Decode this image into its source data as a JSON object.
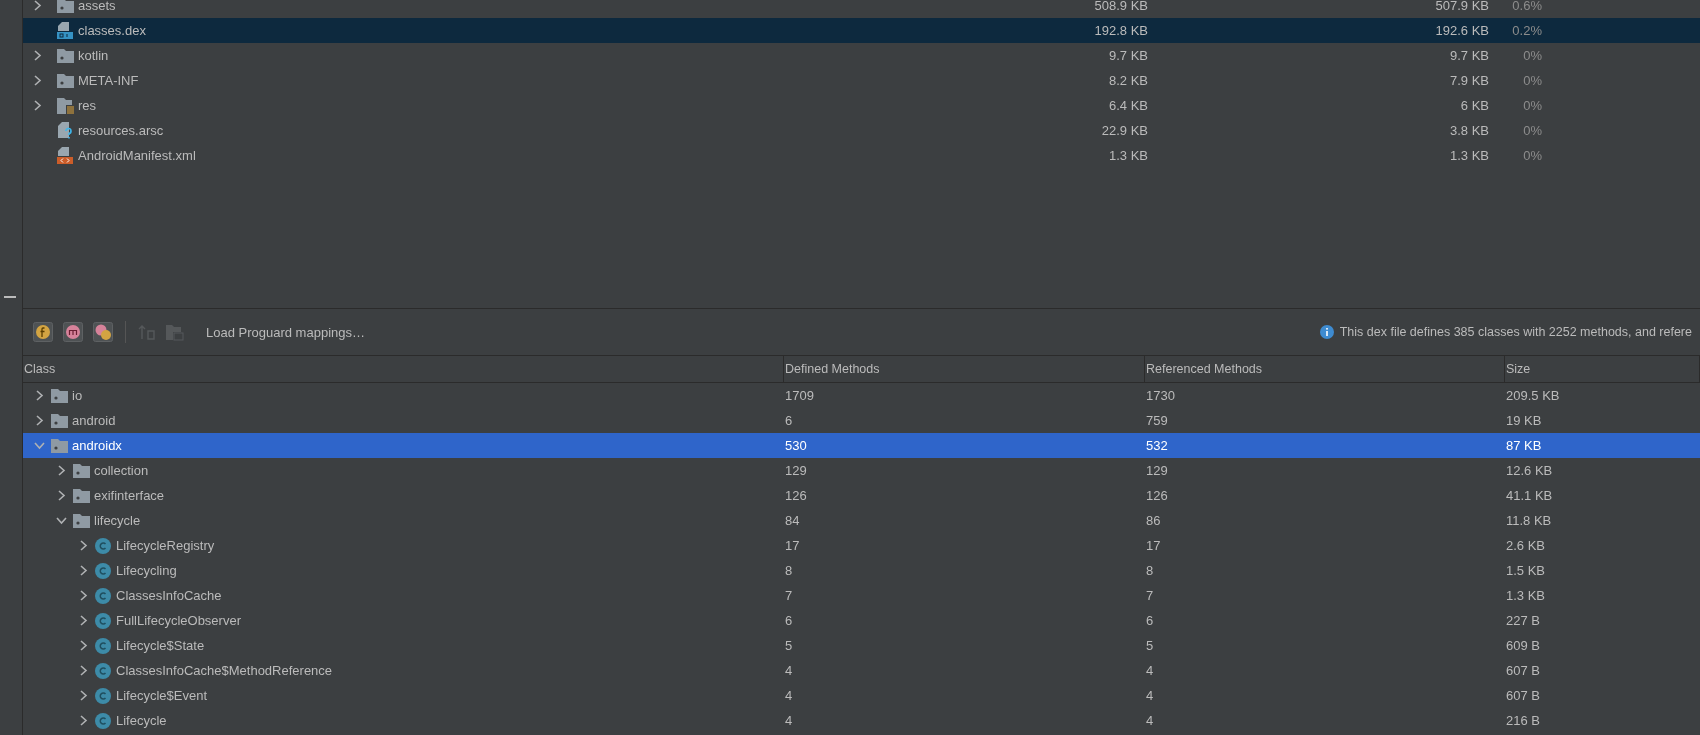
{
  "apk_tree": {
    "rows": [
      {
        "name": "assets",
        "kind": "folder",
        "selected": false,
        "raw_size": "508.9 KB",
        "download_size": "507.9 KB",
        "percent": "0.6%"
      },
      {
        "name": "classes.dex",
        "kind": "dex",
        "selected": true,
        "raw_size": "192.8 KB",
        "download_size": "192.6 KB",
        "percent": "0.2%"
      },
      {
        "name": "kotlin",
        "kind": "folder",
        "selected": false,
        "raw_size": "9.7 KB",
        "download_size": "9.7 KB",
        "percent": "0%"
      },
      {
        "name": "META-INF",
        "kind": "folder",
        "selected": false,
        "raw_size": "8.2 KB",
        "download_size": "7.9 KB",
        "percent": "0%"
      },
      {
        "name": "res",
        "kind": "res",
        "selected": false,
        "raw_size": "6.4 KB",
        "download_size": "6 KB",
        "percent": "0%"
      },
      {
        "name": "resources.arsc",
        "kind": "arsc",
        "selected": false,
        "raw_size": "22.9 KB",
        "download_size": "3.8 KB",
        "percent": "0%"
      },
      {
        "name": "AndroidManifest.xml",
        "kind": "manifest",
        "selected": false,
        "raw_size": "1.3 KB",
        "download_size": "1.3 KB",
        "percent": "0%"
      }
    ]
  },
  "toolbar": {
    "buttons": [
      {
        "kind": "fields",
        "disabled": false
      },
      {
        "kind": "methods",
        "disabled": false
      },
      {
        "kind": "referenced",
        "disabled": false
      },
      {
        "kind": "deobfuscate",
        "disabled": true
      },
      {
        "kind": "load-file",
        "disabled": true
      }
    ],
    "load_button": "Load Proguard mappings…",
    "info": "This dex file defines 385 classes with 2252 methods, and refere"
  },
  "class_table": {
    "columns": [
      "Class",
      "Defined Methods",
      "Referenced Methods",
      "Size"
    ],
    "rows": [
      {
        "name": "io",
        "kind": "package",
        "expanded": false,
        "selected": false,
        "defined": "1709",
        "referenced": "1730",
        "size": "209.5 KB"
      },
      {
        "name": "android",
        "kind": "package",
        "expanded": false,
        "selected": false,
        "defined": "6",
        "referenced": "759",
        "size": "19 KB"
      },
      {
        "name": "androidx",
        "kind": "package",
        "expanded": true,
        "selected": true,
        "defined": "530",
        "referenced": "532",
        "size": "87 KB",
        "children": [
          {
            "name": "collection",
            "kind": "package",
            "expanded": false,
            "selected": false,
            "defined": "129",
            "referenced": "129",
            "size": "12.6 KB"
          },
          {
            "name": "exifinterface",
            "kind": "package",
            "expanded": false,
            "selected": false,
            "defined": "126",
            "referenced": "126",
            "size": "41.1 KB"
          },
          {
            "name": "lifecycle",
            "kind": "package",
            "expanded": true,
            "selected": false,
            "defined": "84",
            "referenced": "86",
            "size": "11.8 KB",
            "children": [
              {
                "name": "LifecycleRegistry",
                "kind": "class",
                "expanded": false,
                "selected": false,
                "defined": "17",
                "referenced": "17",
                "size": "2.6 KB"
              },
              {
                "name": "Lifecycling",
                "kind": "class",
                "expanded": false,
                "selected": false,
                "defined": "8",
                "referenced": "8",
                "size": "1.5 KB"
              },
              {
                "name": "ClassesInfoCache",
                "kind": "class",
                "expanded": false,
                "selected": false,
                "defined": "7",
                "referenced": "7",
                "size": "1.3 KB"
              },
              {
                "name": "FullLifecycleObserver",
                "kind": "class",
                "expanded": false,
                "selected": false,
                "defined": "6",
                "referenced": "6",
                "size": "227 B"
              },
              {
                "name": "Lifecycle$State",
                "kind": "class",
                "expanded": false,
                "selected": false,
                "defined": "5",
                "referenced": "5",
                "size": "609 B"
              },
              {
                "name": "ClassesInfoCache$MethodReference",
                "kind": "class",
                "expanded": false,
                "selected": false,
                "defined": "4",
                "referenced": "4",
                "size": "607 B"
              },
              {
                "name": "Lifecycle$Event",
                "kind": "class",
                "expanded": false,
                "selected": false,
                "defined": "4",
                "referenced": "4",
                "size": "607 B"
              },
              {
                "name": "Lifecycle",
                "kind": "class",
                "expanded": false,
                "selected": false,
                "defined": "4",
                "referenced": "4",
                "size": "216 B"
              }
            ]
          }
        ]
      }
    ]
  }
}
